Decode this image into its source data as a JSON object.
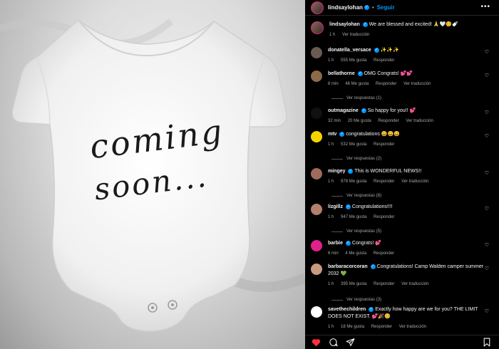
{
  "post": {
    "username": "lindsaylohan",
    "follow_label": "Seguir",
    "more_icon": "more-icon",
    "image_text_line1": "coming",
    "image_text_line2": "soon..."
  },
  "caption": {
    "username": "lindsaylohan",
    "text": "We are blessed and excited! 🙏🤍😊🍼",
    "time": "1 h",
    "translate": "Ver traducción"
  },
  "comments": [
    {
      "user": "donatella_versace",
      "text": "✨✨✨",
      "time": "1 h",
      "likes": "555 Me gusta",
      "reply": "Responder",
      "translate": "",
      "replies": "",
      "avatar": "#6b5a52"
    },
    {
      "user": "bellathorne",
      "text": "OMG Congrats! 💕💕",
      "time": "8 min",
      "likes": "46 Me gusta",
      "reply": "Responder",
      "translate": "Ver traducción",
      "replies": "Ver respuestas (1)",
      "avatar": "#8b6a4a"
    },
    {
      "user": "outmagazine",
      "text": "So happy for you!! 💕",
      "time": "32 min",
      "likes": "20 Me gusta",
      "reply": "Responder",
      "translate": "Ver traducción",
      "replies": "",
      "avatar": "#111111"
    },
    {
      "user": "mtv",
      "text": "congratulations 😄😄😄",
      "time": "1 h",
      "likes": "532 Me gusta",
      "reply": "Responder",
      "translate": "",
      "replies": "Ver respuestas (2)",
      "avatar": "#f5d300"
    },
    {
      "user": "mingey",
      "text": "This is WONDERFUL NEWS!!",
      "time": "1 h",
      "likes": "978 Me gusta",
      "reply": "Responder",
      "translate": "Ver traducción",
      "replies": "Ver respuestas (8)",
      "avatar": "#a06b5a"
    },
    {
      "user": "lizgillz",
      "text": "Congratulations!!!!",
      "time": "1 h",
      "likes": "947 Me gusta",
      "reply": "Responder",
      "translate": "",
      "replies": "Ver respuestas (5)",
      "avatar": "#b47f6a"
    },
    {
      "user": "barbie",
      "text": "Congrats! 💕",
      "time": "6 min",
      "likes": "4 Me gusta",
      "reply": "Responder",
      "translate": "",
      "replies": "",
      "avatar": "#e0218a"
    },
    {
      "user": "barbaracorcoran",
      "text": "Congratulations! Camp Walden camper summer 2032 💚",
      "time": "1 h",
      "likes": "395 Me gusta",
      "reply": "Responder",
      "translate": "Ver traducción",
      "replies": "Ver respuestas (3)",
      "avatar": "#c89a80"
    },
    {
      "user": "savethechildren",
      "text": "Exactly how happy are we for you? THE LIMIT DOES NOT EXIST. 💕🎉😊",
      "time": "1 h",
      "likes": "18 Me gusta",
      "reply": "Responder",
      "translate": "Ver traducción",
      "replies": "",
      "avatar": "#ffffff"
    }
  ],
  "actions": {
    "like_icon": "heart-icon",
    "comment_icon": "comment-icon",
    "share_icon": "share-icon",
    "save_icon": "bookmark-icon",
    "like_color": "#ff3040"
  }
}
